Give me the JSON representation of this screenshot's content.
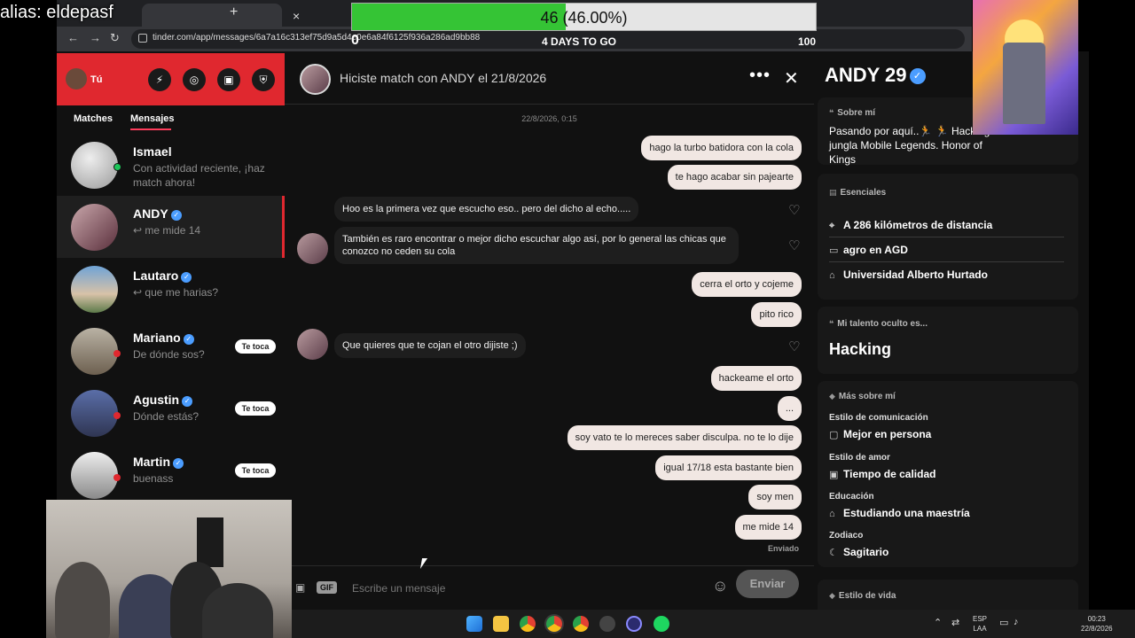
{
  "overlay": {
    "alias": "alias: eldepasf",
    "goal": {
      "text": "46 (46.00%)",
      "min": "0",
      "max": "100",
      "days_left": "4 DAYS TO GO",
      "progress": 0.46
    }
  },
  "browser": {
    "url": "tinder.com/app/messages/6a7a16c313ef75d9a5d4e0e6a84f6125f936a286ad9bb88",
    "nav_back": "←",
    "nav_forward": "→",
    "nav_reload": "↻",
    "tab_close": "×",
    "new_tab": "+"
  },
  "sidebar": {
    "me_label": "Tú",
    "header_icons": [
      "bolt-icon",
      "compass-icon",
      "briefcase-icon",
      "shield-icon"
    ],
    "tabs": [
      {
        "label": "Matches"
      },
      {
        "label": "Mensajes"
      }
    ],
    "conversations": [
      {
        "name": "Ismael",
        "preview": "Con actividad reciente, ¡haz match ahora!",
        "verified": false,
        "turn": ""
      },
      {
        "name": "ANDY",
        "preview": "↩ me mide 14",
        "verified": true,
        "turn": ""
      },
      {
        "name": "Lautaro",
        "preview": "↩ que me harias?",
        "verified": true,
        "turn": ""
      },
      {
        "name": "Mariano",
        "preview": "De dónde sos?",
        "verified": true,
        "turn": "Te toca"
      },
      {
        "name": "Agustin",
        "preview": "Dónde estás?",
        "verified": true,
        "turn": "Te toca"
      },
      {
        "name": "Martin",
        "preview": "buenass",
        "verified": true,
        "turn": "Te toca"
      }
    ]
  },
  "chat": {
    "title": "Hiciste match con ANDY el 21/8/2026",
    "more": "•••",
    "close": "✕",
    "timestamp": "22/8/2026, 0:15",
    "messages": [
      {
        "text": "hago la turbo batidora con la cola"
      },
      {
        "text": "te hago acabar sin pajearte"
      },
      {
        "text": "Hoo es la primera vez que escucho eso.. pero del dicho al echo....."
      },
      {
        "text": "También es raro encontrar o mejor dicho escuchar algo así, por lo general las chicas que conozco no ceden su cola"
      },
      {
        "text": "cerra el orto y cojeme"
      },
      {
        "text": "pito rico"
      },
      {
        "text": "Que quieres que te cojan el otro dijiste ;)"
      },
      {
        "text": "hackeame el orto"
      },
      {
        "text": "..."
      },
      {
        "text": "soy vato te lo mereces saber disculpa. no te lo dije"
      },
      {
        "text": "igual 17/18 esta bastante bien"
      },
      {
        "text": "soy men"
      },
      {
        "text": "me mide 14"
      }
    ],
    "sent_label": "Enviado",
    "composer": {
      "placeholder": "Escribe un mensaje",
      "gif": "GIF",
      "send": "Enviar"
    }
  },
  "profile": {
    "name": "ANDY 29",
    "about_title": "Sobre mí",
    "about_text": "Pasando por aquí..🏃 🏃 Hacking jungla Mobile Legends. Honor of Kings",
    "essentials_title": "Esenciales",
    "essentials": [
      {
        "icon": "pin-icon",
        "text": "A 286 kilómetros de distancia"
      },
      {
        "icon": "briefcase-icon",
        "text": "agro en AGD"
      },
      {
        "icon": "graduation-icon",
        "text": "Universidad Alberto Hurtado"
      }
    ],
    "talent_title": "Mi talento oculto es...",
    "talent": "Hacking",
    "more_title": "Más sobre mí",
    "more": [
      {
        "label": "Estilo de comunicación",
        "value": "Mejor en persona"
      },
      {
        "label": "Estilo de amor",
        "value": "Tiempo de calidad"
      },
      {
        "label": "Educación",
        "value": "Estudiando una maestría"
      },
      {
        "label": "Zodiaco",
        "value": "Sagitario"
      }
    ],
    "lifestyle_title": "Estilo de vida"
  },
  "taskbar": {
    "lang_1": "ESP",
    "lang_2": "LAA",
    "time": "00:23",
    "date": "22/8/2026"
  }
}
